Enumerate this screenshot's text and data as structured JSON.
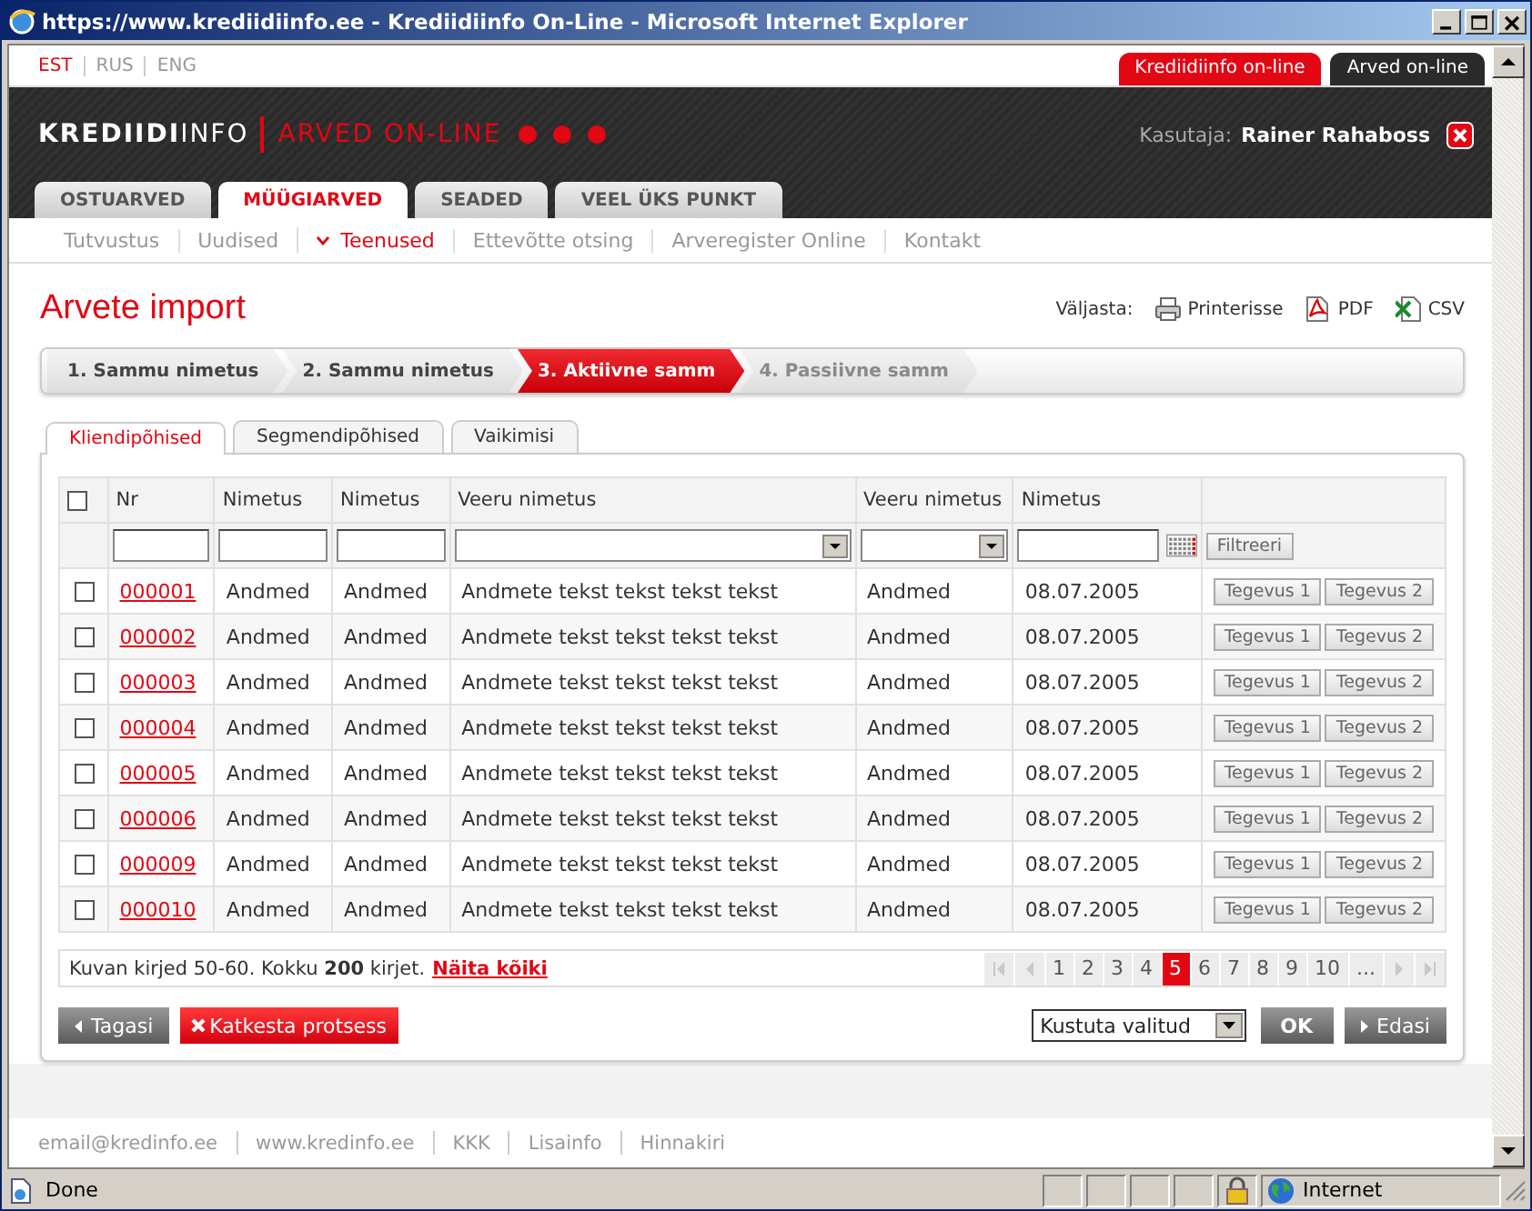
{
  "window": {
    "title": "https://www.krediidiinfo.ee - Krediidiinfo On-Line - Microsoft Internet Explorer"
  },
  "languages": [
    {
      "label": "EST",
      "selected": true
    },
    {
      "label": "RUS",
      "selected": false
    },
    {
      "label": "ENG",
      "selected": false
    }
  ],
  "site_tabs": [
    {
      "label": "Krediidiinfo on-line",
      "selected": false
    },
    {
      "label": "Arved on-line",
      "selected": true
    }
  ],
  "logo": {
    "brand": "**KREDIIDI**INFO",
    "product": "ARVED ON-LINE"
  },
  "user": {
    "label": "Kasutaja:",
    "name": "Rainer Rahaboss"
  },
  "main_tabs": [
    {
      "label": "OSTUARVED",
      "selected": false
    },
    {
      "label": "MÜÜGIARVED",
      "selected": true
    },
    {
      "label": "SEADED",
      "selected": false
    },
    {
      "label": "VEEL ÜKS PUNKT",
      "selected": false
    }
  ],
  "sub_nav": [
    {
      "label": "Tutvustus",
      "selected": false
    },
    {
      "label": "Uudised",
      "selected": false
    },
    {
      "label": "Teenused",
      "selected": true
    },
    {
      "label": "Ettevõtte otsing",
      "selected": false
    },
    {
      "label": "Arveregister Online",
      "selected": false
    },
    {
      "label": "Kontakt",
      "selected": false
    }
  ],
  "page_title": "Arvete import",
  "export": {
    "label": "Väljasta:",
    "items": [
      {
        "kind": "print",
        "label": "Printerisse"
      },
      {
        "kind": "pdf",
        "label": "PDF"
      },
      {
        "kind": "csv",
        "label": "CSV"
      }
    ]
  },
  "steps": [
    {
      "label": "1. Sammu nimetus",
      "selected": false,
      "disabled": false
    },
    {
      "label": "2. Sammu nimetus",
      "selected": false,
      "disabled": false
    },
    {
      "label": "3. Aktiivne samm",
      "selected": true,
      "disabled": false
    },
    {
      "label": "4. Passiivne samm",
      "selected": false,
      "disabled": true
    }
  ],
  "content_tabs": [
    {
      "label": "Kliendipõhised",
      "selected": true
    },
    {
      "label": "Segmendipõhised",
      "selected": false
    },
    {
      "label": "Vaikimisi",
      "selected": false
    }
  ],
  "table": {
    "select_all": {
      "checked": false
    },
    "columns": [
      "Nr",
      "Nimetus",
      "Nimetus",
      "Veeru nimetus",
      "Veeru nimetus",
      "Nimetus"
    ],
    "filters": [
      {
        "kind": "text"
      },
      {
        "kind": "text"
      },
      {
        "kind": "text"
      },
      {
        "kind": "select"
      },
      {
        "kind": "select"
      },
      {
        "kind": "date"
      }
    ],
    "filter_button": "Filtreeri",
    "rows": [
      {
        "checked": false,
        "cells": [
          "000001",
          "Andmed",
          "Andmed",
          "Andmete tekst tekst tekst tekst",
          "Andmed",
          "08.07.2005"
        ],
        "actions": [
          "Tegevus 1",
          "Tegevus 2"
        ]
      },
      {
        "checked": false,
        "cells": [
          "000002",
          "Andmed",
          "Andmed",
          "Andmete tekst tekst tekst tekst",
          "Andmed",
          "08.07.2005"
        ],
        "actions": [
          "Tegevus 1",
          "Tegevus 2"
        ]
      },
      {
        "checked": false,
        "cells": [
          "000003",
          "Andmed",
          "Andmed",
          "Andmete tekst tekst tekst tekst",
          "Andmed",
          "08.07.2005"
        ],
        "actions": [
          "Tegevus 1",
          "Tegevus 2"
        ]
      },
      {
        "checked": false,
        "cells": [
          "000004",
          "Andmed",
          "Andmed",
          "Andmete tekst tekst tekst tekst",
          "Andmed",
          "08.07.2005"
        ],
        "actions": [
          "Tegevus 1",
          "Tegevus 2"
        ]
      },
      {
        "checked": false,
        "cells": [
          "000005",
          "Andmed",
          "Andmed",
          "Andmete tekst tekst tekst tekst",
          "Andmed",
          "08.07.2005"
        ],
        "actions": [
          "Tegevus 1",
          "Tegevus 2"
        ]
      },
      {
        "checked": false,
        "cells": [
          "000006",
          "Andmed",
          "Andmed",
          "Andmete tekst tekst tekst tekst",
          "Andmed",
          "08.07.2005"
        ],
        "actions": [
          "Tegevus 1",
          "Tegevus 2"
        ]
      },
      {
        "checked": false,
        "cells": [
          "000009",
          "Andmed",
          "Andmed",
          "Andmete tekst tekst tekst tekst",
          "Andmed",
          "08.07.2005"
        ],
        "actions": [
          "Tegevus 1",
          "Tegevus 2"
        ]
      },
      {
        "checked": false,
        "cells": [
          "000010",
          "Andmed",
          "Andmed",
          "Andmete tekst tekst tekst tekst",
          "Andmed",
          "08.07.2005"
        ],
        "actions": [
          "Tegevus 1",
          "Tegevus 2"
        ]
      }
    ]
  },
  "pager": {
    "summary": "Kuvan kirjed 50-60. Kokku **200** kirjet.",
    "show_all": "Näita kõiki",
    "pages": [
      {
        "label": "1",
        "selected": false
      },
      {
        "label": "2",
        "selected": false
      },
      {
        "label": "3",
        "selected": false
      },
      {
        "label": "4",
        "selected": false
      },
      {
        "label": "5",
        "selected": true
      },
      {
        "label": "6",
        "selected": false
      },
      {
        "label": "7",
        "selected": false
      },
      {
        "label": "8",
        "selected": false
      },
      {
        "label": "9",
        "selected": false
      },
      {
        "label": "10",
        "selected": false
      },
      {
        "label": "...",
        "selected": false
      }
    ]
  },
  "actions": {
    "back": "Tagasi",
    "cancel": "Katkesta protsess",
    "bulk_select": "Kustuta valitud",
    "ok": "OK",
    "next": "Edasi"
  },
  "footer": [
    "email@kredinfo.ee",
    "www.kredinfo.ee",
    "KKK",
    "Lisainfo",
    "Hinnakiri"
  ],
  "status_bar": {
    "text": "Done",
    "zone": "Internet"
  }
}
